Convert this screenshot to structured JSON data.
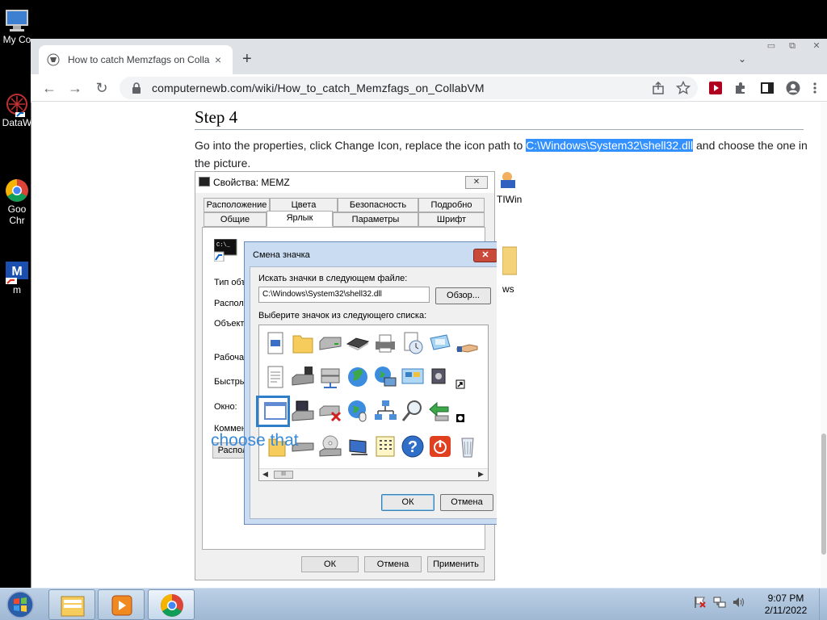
{
  "desktop": {
    "icons": [
      {
        "label": "My Co",
        "icon": "computer-icon"
      },
      {
        "label": "DataW",
        "icon": "datawiper-icon"
      },
      {
        "label": "Goo",
        "label2": "Chr",
        "icon": "chrome-icon"
      },
      {
        "label": "m",
        "icon": "memz-icon"
      }
    ]
  },
  "browser": {
    "tab": {
      "title": "How to catch Memzfags on Colla",
      "close": "×"
    },
    "new_tab": "+",
    "tab_menu": "⌄",
    "window_controls": {
      "minimize": "▭",
      "maximize": "⧉",
      "close": "✕"
    },
    "nav": {
      "back": "←",
      "forward": "→",
      "reload": "↻"
    },
    "url": "computernewb.com/wiki/How_to_catch_Memzfags_on_CollabVM"
  },
  "article": {
    "heading": "Step 4",
    "para_before": "Go into the properties, click Change Icon, replace the icon path to ",
    "para_highlight": "C:\\Windows\\System32\\shell32.dll",
    "para_after": " and choose the one in the picture.",
    "behind_fragments": [
      "TIWin",
      "ws"
    ]
  },
  "properties_dialog": {
    "title": "Свойства: MEMZ",
    "close": "✕",
    "tabs_top": [
      "Расположение",
      "Цвета",
      "Безопасность",
      "Подробно"
    ],
    "tabs_bottom": [
      "Общие",
      "Ярлык",
      "Параметры",
      "Шрифт"
    ],
    "active_tab": "Ярлык",
    "fields": [
      "Тип объ",
      "Располо",
      "Объект",
      "Рабочая",
      "Быстры",
      "Окно:",
      "Коммен"
    ],
    "loc_button": "Распол",
    "buttons": {
      "ok": "ОК",
      "cancel": "Отмена",
      "apply": "Применить"
    }
  },
  "change_icon_dialog": {
    "title": "Смена значка",
    "close": "✕",
    "search_label": "Искать значки в следующем файле:",
    "path_value": "C:\\Windows\\System32\\shell32.dll",
    "browse": "Обзор...",
    "list_label": "Выберите значок из следующего списка:",
    "ok": "ОК",
    "cancel": "Отмена",
    "scroll_thumb": "III"
  },
  "annotation": "choose that",
  "taskbar": {
    "apps": [
      "explorer",
      "media-player",
      "chrome"
    ],
    "time": "9:07 PM",
    "date": "2/11/2022"
  },
  "colors": {
    "highlight": "#3390ff",
    "annotation": "#3a8ad8",
    "selection_box": "#2e7ec9"
  }
}
